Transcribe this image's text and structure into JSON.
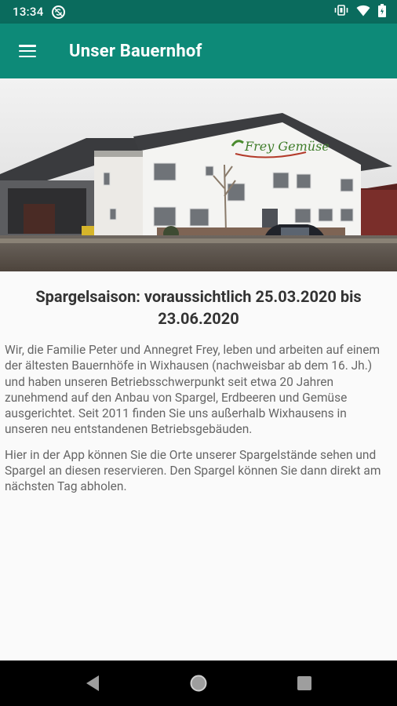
{
  "status_bar": {
    "time": "13:34",
    "notification_icon": "sync-disabled-icon",
    "icons": [
      "vibrate-icon",
      "wifi-icon",
      "battery-icon"
    ]
  },
  "app_bar": {
    "menu_icon": "hamburger-menu-icon",
    "title": "Unser Bauernhof"
  },
  "hero": {
    "sign_text": "Frey Gemüse"
  },
  "content": {
    "headline": "Spargelsaison: voraussichtlich 25.03.2020 bis 23.06.2020",
    "paragraph_1": "Wir, die Familie Peter und Annegret Frey, leben und arbeiten auf einem der ältesten Bauernhöfe in Wixhausen (nachweisbar ab dem 16. Jh.) und haben unseren Betriebsschwerpunkt seit etwa 20 Jahren zunehmend auf den Anbau von Spargel, Erdbeeren und Gemüse ausgerichtet. Seit 2011 finden Sie uns außerhalb Wixhausens in unseren neu entstandenen Betriebsgebäuden.",
    "paragraph_2": "Hier in der App können Sie die Orte unserer Spargelstände sehen und Spargel an diesen reservieren. Den Spargel können Sie dann direkt am nächsten Tag abholen."
  },
  "nav_bar": {
    "buttons": [
      "back-icon",
      "home-icon",
      "recents-icon"
    ]
  },
  "colors": {
    "status_bar": "#0a6b5d",
    "app_bar": "#0d8a78",
    "background": "#fafafa",
    "headline_text": "#333333",
    "body_text": "#666666"
  }
}
